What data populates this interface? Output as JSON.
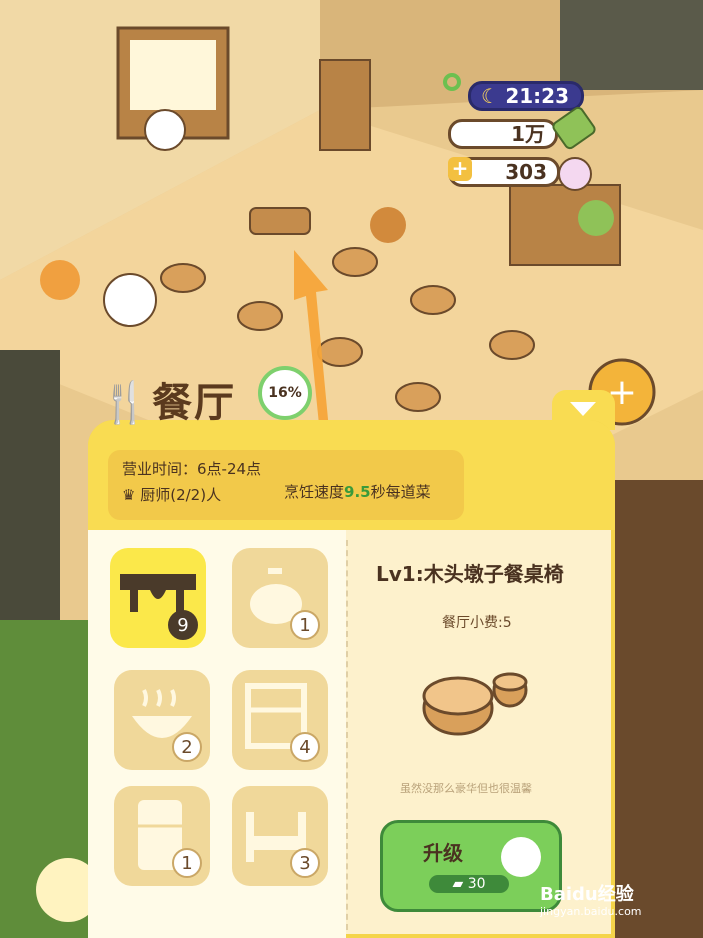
{
  "hud": {
    "clock": "21:23",
    "coins": "1万",
    "gems": "303"
  },
  "panel": {
    "title": "餐厅",
    "progress": "16%",
    "hours": "营业时间：6点-24点",
    "chef_label": "厨师(2/2)人",
    "speed_prefix": "烹饪速度",
    "speed_value": "9.5",
    "speed_suffix": "秒每道菜",
    "categories": [
      {
        "name": "table",
        "count": "9",
        "selected": true
      },
      {
        "name": "piggy-bank",
        "count": "1",
        "selected": false
      },
      {
        "name": "steaming-pot",
        "count": "2",
        "selected": false
      },
      {
        "name": "shelf",
        "count": "4",
        "selected": false
      },
      {
        "name": "fridge",
        "count": "1",
        "selected": false
      },
      {
        "name": "bed",
        "count": "3",
        "selected": false
      }
    ],
    "detail": {
      "title": "Lv1:木头墩子餐桌椅",
      "tip": "餐厅小费:5",
      "description": "虽然没那么豪华但也很温馨"
    },
    "upgrade": {
      "label": "升级",
      "cost": "30"
    }
  },
  "watermark": {
    "brand": "Baidu经验",
    "url": "jingyan.baidu.com"
  },
  "colors": {
    "panel_yellow": "#f9dc52",
    "floor": "#e9c98e",
    "upgrade_green": "#7ccf5a"
  }
}
